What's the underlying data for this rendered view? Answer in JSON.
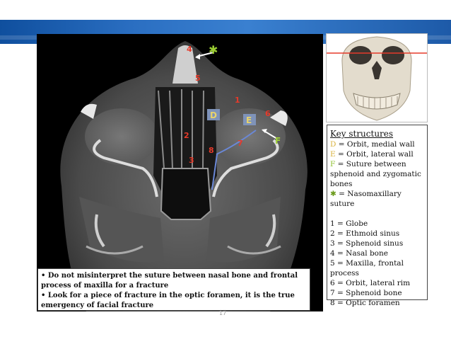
{
  "colors": {
    "banner": "#2b6fc2",
    "label_red": "#e53a2a",
    "label_blue_box": "#7f93b9",
    "label_yellow": "#d9b23c",
    "label_green": "#8fbf2f",
    "suture_green": "#9acd32"
  },
  "ct_labels": {
    "n1": "1",
    "n2": "2",
    "n3": "3",
    "n4": "4",
    "n5": "5",
    "n6": "6",
    "n7": "7",
    "n8": "8",
    "D": "D",
    "E": "E",
    "F": "F"
  },
  "key": {
    "title": "Key structures",
    "items": [
      {
        "sym": "D",
        "text": " = Orbit, medial wall"
      },
      {
        "sym": "E",
        "text": " = Orbit, lateral wall"
      },
      {
        "sym": "F",
        "text": " = Suture between sphenoid and zygomatic bones"
      },
      {
        "sym": "✱",
        "text": " = Nasomaxillary suture"
      }
    ],
    "numbered": [
      "1 = Globe",
      "2 = Ethmoid sinus",
      "3 = Sphenoid sinus",
      "4 = Nasal bone",
      "5 = Maxilla, frontal process",
      "6 = Orbit, lateral rim",
      "7 = Sphenoid bone",
      "8 = Optic foramen"
    ]
  },
  "notes": [
    "• Do not misinterpret the suture between nasal bone and frontal process of maxilla for a fracture",
    "• Look for a piece of fracture in the optic foramen, it is the true emergency of facial fracture"
  ],
  "page_number": "17"
}
